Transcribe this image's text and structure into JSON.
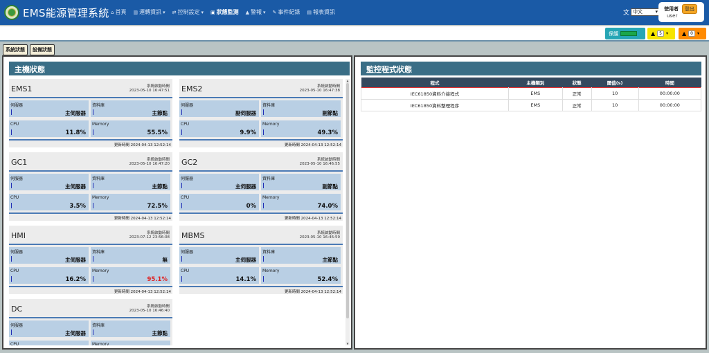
{
  "header": {
    "title": "EMS能源管理系統",
    "nav": [
      {
        "label": "首頁",
        "icon": "home-icon",
        "glyph": "⌂"
      },
      {
        "label": "運轉資訊",
        "icon": "chart-icon",
        "glyph": "▥",
        "dropdown": true
      },
      {
        "label": "控制設定",
        "icon": "control-icon",
        "glyph": "⇄",
        "dropdown": true
      },
      {
        "label": "狀態監測",
        "icon": "monitor-icon",
        "glyph": "▣",
        "active": true
      },
      {
        "label": "警報",
        "icon": "alarm-icon",
        "glyph": "▲",
        "dropdown": true
      },
      {
        "label": "事件紀錄",
        "icon": "log-icon",
        "glyph": "✎"
      },
      {
        "label": "報表資訊",
        "icon": "report-icon",
        "glyph": "▤"
      }
    ],
    "lang": {
      "icon": "translate-icon",
      "selected": "中文"
    },
    "user": {
      "label": "使用者",
      "name": "user",
      "logout": "登出"
    }
  },
  "alerts": {
    "protect_label": "保護",
    "warn_yellow_count": "5",
    "warn_orange_count": "0"
  },
  "subtabs": [
    "系統狀態",
    "設備狀態"
  ],
  "host_panel": {
    "title": "主機狀態",
    "boot_label": "系統啟動時間",
    "update_label": "更新時間",
    "labels": {
      "server": "伺服器",
      "db": "資料庫",
      "cpu": "CPU",
      "memory": "Memory"
    },
    "hosts": [
      {
        "name": "EMS1",
        "boot": "2023-05-10 16:47:51",
        "server": "主伺服器",
        "db": "主節點",
        "cpu": "11.8%",
        "mem": "55.5%",
        "update": "2024-04-13 12:52:14"
      },
      {
        "name": "EMS2",
        "boot": "2023-05-10 16:47:38",
        "server": "副伺服器",
        "db": "副節點",
        "cpu": "9.9%",
        "mem": "49.3%",
        "update": "2024-04-13 12:52:14"
      },
      {
        "name": "GC1",
        "boot": "2023-05-10 16:47:20",
        "server": "主伺服器",
        "db": "主節點",
        "cpu": "3.5%",
        "mem": "72.5%",
        "update": "2024-04-13 12:52:14"
      },
      {
        "name": "GC2",
        "boot": "2023-05-10 16:46:55",
        "server": "主伺服器",
        "db": "副節點",
        "cpu": "0%",
        "mem": "74.0%",
        "update": "2024-04-13 12:52:14"
      },
      {
        "name": "HMI",
        "boot": "2023-07-12 23:56:08",
        "server": "主伺服器",
        "db": "無",
        "cpu": "16.2%",
        "mem": "95.1%",
        "mem_alert": true,
        "update": "2024-04-13 12:52:14"
      },
      {
        "name": "MBMS",
        "boot": "2023-05-10 16:46:59",
        "server": "主伺服器",
        "db": "主節點",
        "cpu": "14.1%",
        "mem": "52.4%",
        "update": "2024-04-13 12:52:14"
      },
      {
        "name": "DC",
        "boot": "2023-05-10 16:46:40",
        "server": "主伺服器",
        "db": "主節點",
        "cpu": "",
        "mem": "",
        "update": ""
      }
    ]
  },
  "program_panel": {
    "title": "監控程式狀態",
    "columns": [
      "程式",
      "主機類別",
      "狀態",
      "閾值(s)",
      "時間"
    ],
    "rows": [
      [
        "IEC61850資料介接程式",
        "EMS",
        "正常",
        "10",
        "00:00:00"
      ],
      [
        "IEC61850資料整理程序",
        "EMS",
        "正常",
        "10",
        "00:00:00"
      ]
    ]
  }
}
